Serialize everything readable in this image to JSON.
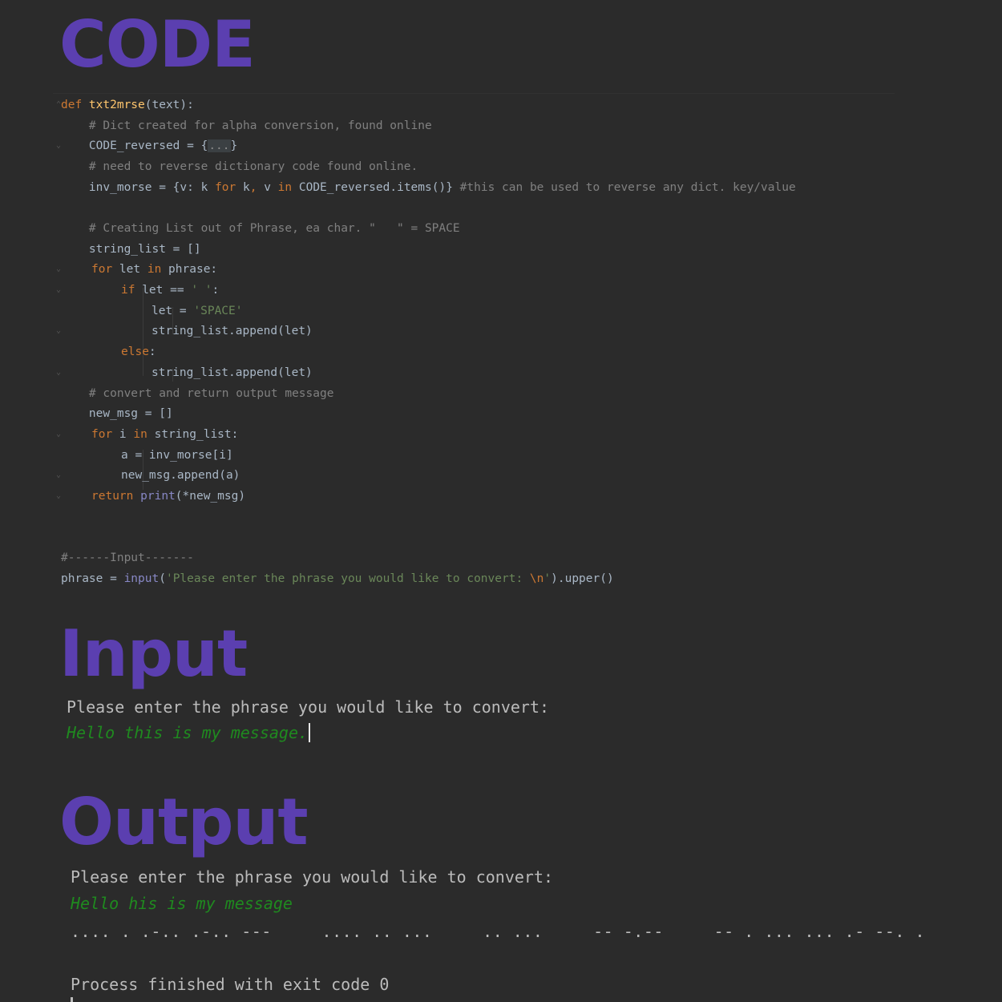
{
  "sections": {
    "code_heading": "CODE",
    "input_heading": "Input",
    "output_heading": "Output"
  },
  "code": {
    "l1_def": "def ",
    "l1_fn": "txt2mrse",
    "l1_rest": "(text):",
    "l2": "    # Dict created for alpha conversion, found online",
    "l3_a": "    CODE_reversed = {",
    "l3_fold": "...",
    "l3_b": "}",
    "l4": "    # need to reverse dictionary code found online.",
    "l5_a": "    inv_morse = {v: k ",
    "l5_for": "for",
    "l5_b": " k",
    "l5_comma": ",",
    "l5_c": " v ",
    "l5_in": "in",
    "l5_d": " CODE_reversed.items()} ",
    "l5_comment": "#this can be used to reverse any dict. key/value",
    "l7": "    # Creating List out of Phrase, ea char. \"   \" = SPACE",
    "l8": "    string_list = []",
    "l9_for": "for",
    "l9_a": " let ",
    "l9_in": "in",
    "l9_b": " phrase:",
    "l10_if": "if",
    "l10_a": " let == ",
    "l10_str": "' '",
    "l10_b": ":",
    "l11_a": "let = ",
    "l11_str": "'SPACE'",
    "l12": "string_list.append(let)",
    "l13_else": "else",
    "l13_b": ":",
    "l14": "string_list.append(let)",
    "l15": "    # convert and return output message",
    "l16": "    new_msg = []",
    "l17_for": "for",
    "l17_a": " i ",
    "l17_in": "in",
    "l17_b": " string_list:",
    "l18": "a = inv_morse[i]",
    "l19": "new_msg.append(a)",
    "l20_return": "return",
    "l20_sp": " ",
    "l20_print": "print",
    "l20_rest": "(*new_msg)",
    "l23": "#------Input-------",
    "l24_a": "phrase = ",
    "l24_input": "input",
    "l24_b": "(",
    "l24_str": "'Please enter the phrase you would like to convert: ",
    "l24_esc": "\\n",
    "l24_str2": "'",
    "l24_c": ").upper()"
  },
  "input_console": {
    "prompt": "Please enter the phrase you would like to convert:",
    "typed": "Hello this is my message."
  },
  "output_console": {
    "prompt": "Please enter the phrase you would like to convert:",
    "echo": "Hello his is my message",
    "morse": ".... . .-.. .-.. ---     .... .. ...     .. ...     -- -.--     -- . ... ... .- --. .",
    "finished": "Process finished with exit code 0"
  },
  "colors": {
    "background": "#2b2b2b",
    "heading": "#5b3fb0",
    "keyword": "#cc7832",
    "function": "#ffc66d",
    "string": "#6a8759",
    "comment": "#808080",
    "builtin": "#8888c6",
    "code_text": "#a9b7c6",
    "console_text": "#bbbbbb",
    "console_input": "#1f8a1f"
  }
}
